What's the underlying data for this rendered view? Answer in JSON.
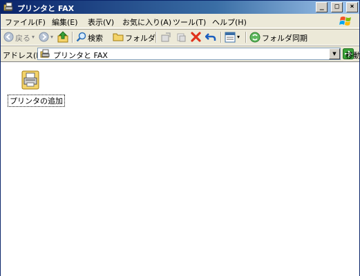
{
  "window": {
    "title": "プリンタと FAX",
    "buttons": {
      "minimize": "_",
      "maximize": "□",
      "close": "×"
    }
  },
  "menu": {
    "items": [
      "ファイル(F)",
      "編集(E)",
      "表示(V)",
      "お気に入り(A)",
      "ツール(T)",
      "ヘルプ(H)"
    ]
  },
  "toolbar": {
    "back_label": "戻る",
    "search_label": "検索",
    "folders_label": "フォルダ",
    "sync_label": "フォルダ同期"
  },
  "address": {
    "label": "アドレス(D)",
    "value": "プリンタと FAX",
    "go_label": "移動"
  },
  "content": {
    "items": [
      {
        "label": "プリンタの追加",
        "icon": "printer-add-icon"
      }
    ]
  },
  "colors": {
    "titlebar_start": "#0a246a",
    "titlebar_end": "#a6caf0",
    "chrome": "#ece9d8",
    "content_bg": "#ffffff"
  }
}
